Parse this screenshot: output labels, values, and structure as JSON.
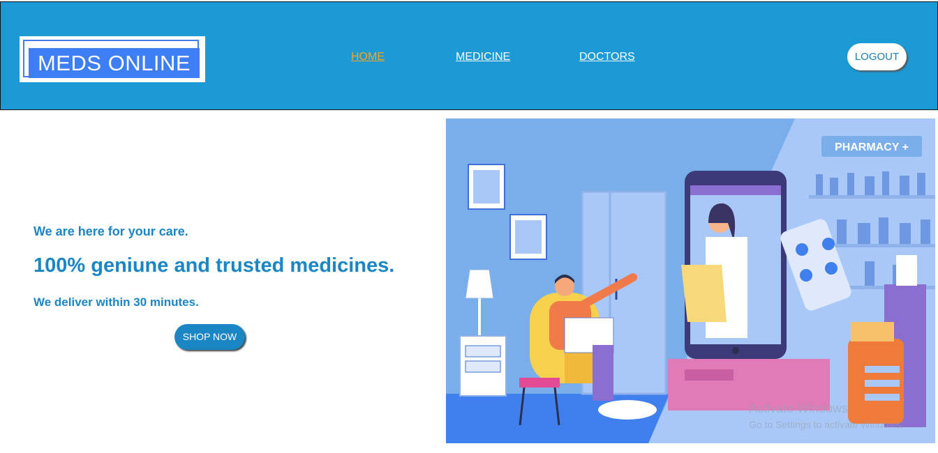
{
  "header": {
    "logo_text": "MEDS ONLINE",
    "nav": {
      "home": "HOME",
      "medicine": "MEDICINE",
      "doctors": "DOCTORS"
    },
    "logout_label": "LOGOUT"
  },
  "hero": {
    "line1": "We are here for your care.",
    "headline": "100% geniune and trusted medicines.",
    "line3": "We deliver within 30 minutes.",
    "cta_label": "SHOP NOW"
  },
  "illustration": {
    "pharmacy_sign": "PHARMACY +"
  },
  "watermark": {
    "title": "Activate Windows",
    "subtitle": "Go to Settings to activate Windows."
  },
  "colors": {
    "header_bg": "#1b9ad6",
    "accent_active": "#f5a623",
    "text_blue": "#1b86c4",
    "logo_blue": "#3d7ef5"
  }
}
